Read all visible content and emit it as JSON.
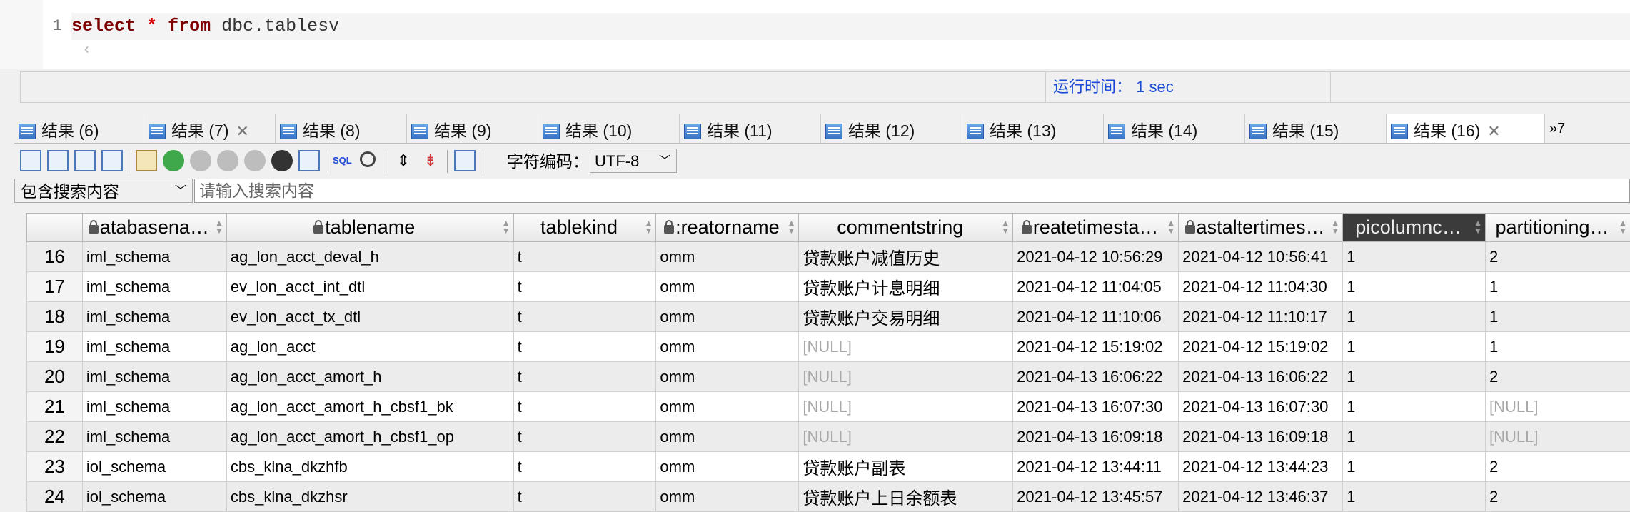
{
  "editor": {
    "line_number": "1",
    "code_kw1": "select",
    "code_star": "*",
    "code_kw2": "from",
    "code_rest": "dbc.tablesv",
    "scroll_arrow": "‹"
  },
  "status": {
    "runtime_label": "运行时间： 1 sec"
  },
  "tabs": [
    {
      "label": "结果 (6)",
      "closable": false
    },
    {
      "label": "结果 (7)",
      "closable": true
    },
    {
      "label": "结果 (8)",
      "closable": false
    },
    {
      "label": "结果 (9)",
      "closable": false
    },
    {
      "label": "结果 (10)",
      "closable": false
    },
    {
      "label": "结果 (11)",
      "closable": false
    },
    {
      "label": "结果 (12)",
      "closable": false
    },
    {
      "label": "结果 (13)",
      "closable": false
    },
    {
      "label": "结果 (14)",
      "closable": false
    },
    {
      "label": "结果 (15)",
      "closable": false
    },
    {
      "label": "结果 (16)",
      "closable": true,
      "active": true
    }
  ],
  "tab_overflow": "»7",
  "toolbar": {
    "encoding_label": "字符编码：",
    "encoding_value": "UTF-8",
    "sql_label": "SQL"
  },
  "search": {
    "mode": "包含搜索内容",
    "placeholder": "请输入搜索内容"
  },
  "grid": {
    "columns": [
      "atabasena…",
      "tablename",
      "tablekind",
      ":reatorname",
      "commentstring",
      "reatetimesta…",
      "astaltertimes…",
      "picolumnc…",
      "partitioning…"
    ],
    "rows": [
      [
        "16",
        "iml_schema",
        "ag_lon_acct_deval_h",
        "t",
        "omm",
        "贷款账户减值历史",
        "2021-04-12 10:56:29",
        "2021-04-12 10:56:41",
        "1",
        "2"
      ],
      [
        "17",
        "iml_schema",
        "ev_lon_acct_int_dtl",
        "t",
        "omm",
        "贷款账户计息明细",
        "2021-04-12 11:04:05",
        "2021-04-12 11:04:30",
        "1",
        "1"
      ],
      [
        "18",
        "iml_schema",
        "ev_lon_acct_tx_dtl",
        "t",
        "omm",
        "贷款账户交易明细",
        "2021-04-12 11:10:06",
        "2021-04-12 11:10:17",
        "1",
        "1"
      ],
      [
        "19",
        "iml_schema",
        "ag_lon_acct",
        "t",
        "omm",
        "[NULL]",
        "2021-04-12 15:19:02",
        "2021-04-12 15:19:02",
        "1",
        "1"
      ],
      [
        "20",
        "iml_schema",
        "ag_lon_acct_amort_h",
        "t",
        "omm",
        "[NULL]",
        "2021-04-13 16:06:22",
        "2021-04-13 16:06:22",
        "1",
        "2"
      ],
      [
        "21",
        "iml_schema",
        "ag_lon_acct_amort_h_cbsf1_bk",
        "t",
        "omm",
        "[NULL]",
        "2021-04-13 16:07:30",
        "2021-04-13 16:07:30",
        "1",
        "[NULL]"
      ],
      [
        "22",
        "iml_schema",
        "ag_lon_acct_amort_h_cbsf1_op",
        "t",
        "omm",
        "[NULL]",
        "2021-04-13 16:09:18",
        "2021-04-13 16:09:18",
        "1",
        "[NULL]"
      ],
      [
        "23",
        "iol_schema",
        "cbs_klna_dkzhfb",
        "t",
        "omm",
        "贷款账户副表",
        "2021-04-12 13:44:11",
        "2021-04-12 13:44:23",
        "1",
        "2"
      ],
      [
        "24",
        "iol_schema",
        "cbs_klna_dkzhsr",
        "t",
        "omm",
        "贷款账户上日余额表",
        "2021-04-12 13:45:57",
        "2021-04-12 13:46:37",
        "1",
        "2"
      ]
    ]
  }
}
